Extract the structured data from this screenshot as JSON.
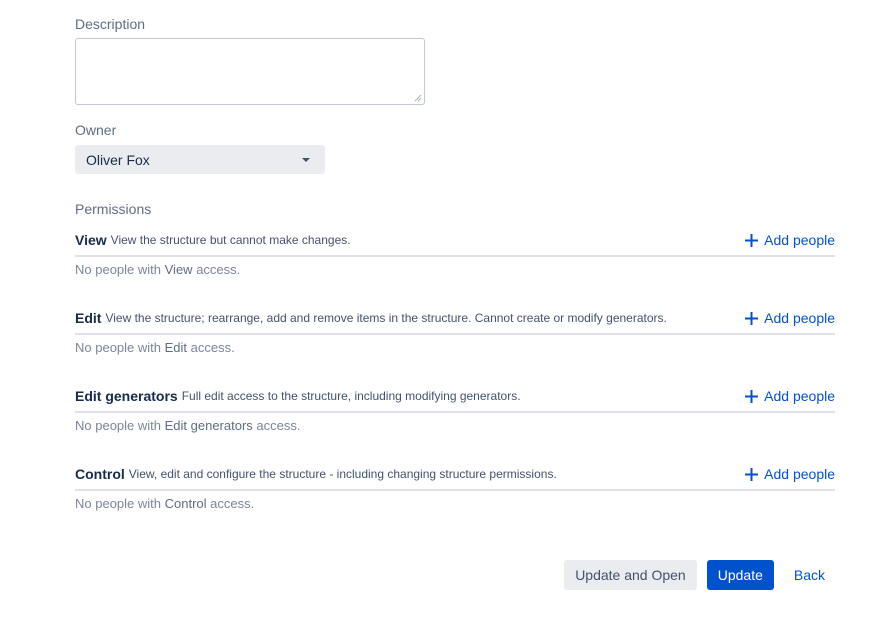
{
  "description": {
    "label": "Description",
    "value": "",
    "placeholder": ""
  },
  "owner": {
    "label": "Owner",
    "selected": "Oliver Fox"
  },
  "permissions": {
    "label": "Permissions",
    "add_label": "Add people",
    "empty_prefix": "No people with",
    "empty_suffix": "access.",
    "levels": [
      {
        "name": "View",
        "description": "View the structure but cannot make changes."
      },
      {
        "name": "Edit",
        "description": "View the structure; rearrange, add and remove items in the structure. Cannot create or modify generators."
      },
      {
        "name": "Edit generators",
        "description": "Full edit access to the structure, including modifying generators."
      },
      {
        "name": "Control",
        "description": "View, edit and configure the structure - including changing structure permissions."
      }
    ]
  },
  "actions": {
    "update_and_open": "Update and Open",
    "update": "Update",
    "back": "Back"
  },
  "colors": {
    "primary": "#0052cc",
    "secondary_bg": "#ebecf0",
    "divider": "#dfe1e6"
  }
}
